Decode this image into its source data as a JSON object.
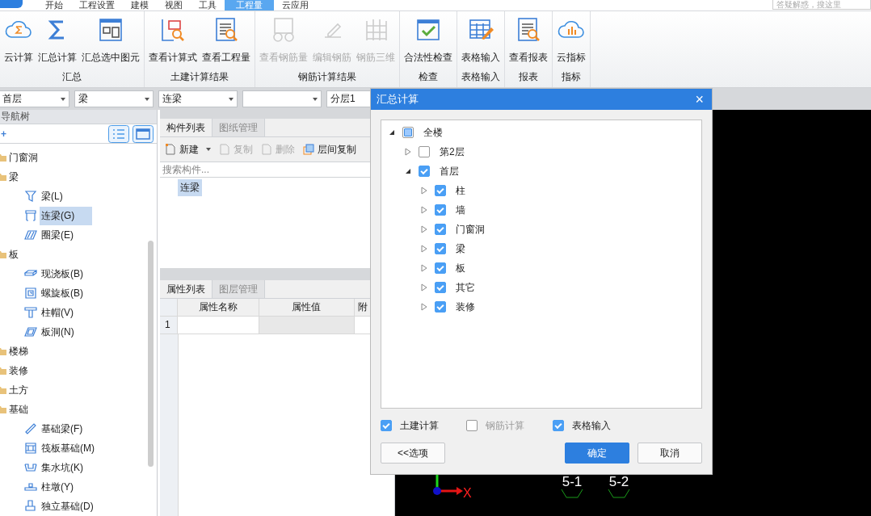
{
  "menu_tabs": [
    {
      "label": "开始",
      "selected": false
    },
    {
      "label": "工程设置",
      "selected": false
    },
    {
      "label": "建模",
      "selected": false
    },
    {
      "label": "视图",
      "selected": false
    },
    {
      "label": "工具",
      "selected": false
    },
    {
      "label": "工程量",
      "selected": true
    },
    {
      "label": "云应用",
      "selected": false
    }
  ],
  "search": {
    "placeholder": "答疑解惑，搜这里"
  },
  "ribbon": [
    {
      "title": "汇总",
      "buttons": [
        {
          "label": "云计算",
          "disabled": false
        },
        {
          "label": "汇总计算",
          "disabled": false
        },
        {
          "label": "汇总选中图元",
          "disabled": false
        }
      ]
    },
    {
      "title": "土建计算结果",
      "buttons": [
        {
          "label": "查看计算式",
          "disabled": false
        },
        {
          "label": "查看工程量",
          "disabled": false
        }
      ]
    },
    {
      "title": "钢筋计算结果",
      "buttons": [
        {
          "label": "查看钢筋量",
          "disabled": true
        },
        {
          "label": "编辑钢筋",
          "disabled": true
        },
        {
          "label": "钢筋三维",
          "disabled": true
        }
      ]
    },
    {
      "title": "检查",
      "buttons": [
        {
          "label": "合法性检查",
          "disabled": false
        }
      ]
    },
    {
      "title": "表格输入",
      "buttons": [
        {
          "label": "表格输入",
          "disabled": false
        }
      ]
    },
    {
      "title": "报表",
      "buttons": [
        {
          "label": "查看报表",
          "disabled": false
        }
      ]
    },
    {
      "title": "指标",
      "buttons": [
        {
          "label": "云指标",
          "disabled": false
        }
      ]
    }
  ],
  "selectors": [
    {
      "value": "首层"
    },
    {
      "value": "梁"
    },
    {
      "value": "连梁"
    }
  ],
  "layer_field": "分层1",
  "nav_tree": {
    "title": "导航树",
    "add": "+",
    "items": [
      {
        "label": "门窗洞"
      },
      {
        "label": "梁",
        "children": [
          {
            "label": "梁(L)",
            "selected": false
          },
          {
            "label": "连梁(G)",
            "selected": true
          },
          {
            "label": "圈梁(E)",
            "selected": false
          }
        ]
      },
      {
        "label": "板",
        "children": [
          {
            "label": "现浇板(B)",
            "selected": false
          },
          {
            "label": "螺旋板(B)",
            "selected": false
          },
          {
            "label": "柱帽(V)",
            "selected": false
          },
          {
            "label": "板洞(N)",
            "selected": false
          }
        ]
      },
      {
        "label": "楼梯"
      },
      {
        "label": "装修"
      },
      {
        "label": "土方"
      },
      {
        "label": "基础",
        "children": [
          {
            "label": "基础梁(F)",
            "selected": false
          },
          {
            "label": "筏板基础(M)",
            "selected": false
          },
          {
            "label": "集水坑(K)",
            "selected": false
          },
          {
            "label": "柱墩(Y)",
            "selected": false
          },
          {
            "label": "独立基础(D)",
            "selected": false
          }
        ]
      }
    ]
  },
  "component_list": {
    "tabs": [
      {
        "label": "构件列表",
        "selected": true
      },
      {
        "label": "图纸管理",
        "selected": false
      }
    ],
    "toolbar": [
      {
        "label": "新建",
        "disabled": false,
        "dropdown": true
      },
      {
        "label": "复制",
        "disabled": true,
        "dropdown": false
      },
      {
        "label": "删除",
        "disabled": true,
        "dropdown": false
      },
      {
        "label": "层间复制",
        "disabled": false,
        "dropdown": false
      }
    ],
    "search": {
      "placeholder": "搜索构件..."
    },
    "items": [
      {
        "label": "连梁",
        "selected": true
      }
    ]
  },
  "properties": {
    "tabs": [
      {
        "label": "属性列表",
        "selected": true
      },
      {
        "label": "图层管理",
        "selected": false
      }
    ],
    "columns": [
      "属性名称",
      "属性值",
      "附"
    ],
    "rows": [
      {
        "number": "1"
      }
    ]
  },
  "viewport": {
    "axis_label": "X",
    "markers": [
      "5-1",
      "5-2"
    ]
  },
  "dialog": {
    "title": "汇总计算",
    "close": "×",
    "tree": [
      {
        "label": "全楼",
        "checked": false,
        "partial": true,
        "expanded": true,
        "children": [
          {
            "label": "第2层",
            "checked": false,
            "expanded": false
          },
          {
            "label": "首层",
            "checked": true,
            "expanded": true,
            "children": [
              {
                "label": "柱",
                "checked": true,
                "expanded": false
              },
              {
                "label": "墙",
                "checked": true,
                "expanded": false
              },
              {
                "label": "门窗洞",
                "checked": true,
                "expanded": false
              },
              {
                "label": "梁",
                "checked": true,
                "expanded": false
              },
              {
                "label": "板",
                "checked": true,
                "expanded": false
              },
              {
                "label": "其它",
                "checked": true,
                "expanded": false
              },
              {
                "label": "装修",
                "checked": true,
                "expanded": false
              }
            ]
          }
        ]
      }
    ],
    "options": [
      {
        "label": "土建计算",
        "checked": true,
        "disabled": false
      },
      {
        "label": "钢筋计算",
        "checked": false,
        "disabled": true
      },
      {
        "label": "表格输入",
        "checked": true,
        "disabled": false
      }
    ],
    "options_button": "<<选项",
    "confirm": "确定",
    "cancel": "取消"
  }
}
